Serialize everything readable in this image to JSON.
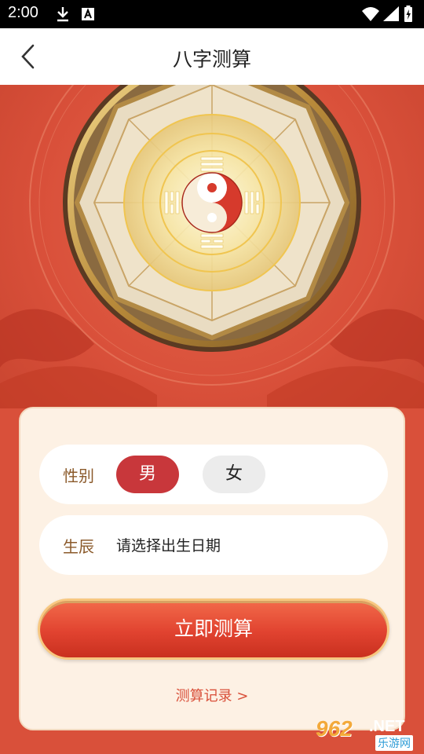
{
  "status_bar": {
    "time": "2:00"
  },
  "nav": {
    "title": "八字测算"
  },
  "form": {
    "gender_label": "性别",
    "gender_options": [
      "男",
      "女"
    ],
    "gender_selected": "男",
    "birth_label": "生辰",
    "birth_placeholder": "请选择出生日期",
    "submit_label": "立即测算",
    "history_link": "测算记录 >"
  },
  "watermark": {
    "number": "962",
    "net": ".NET",
    "site": "乐游网"
  },
  "colors": {
    "background": "#d9503a",
    "primary_red": "#c8373b",
    "card_bg": "#fdf1e4",
    "label_brown": "#8b5a2b",
    "gold": "#d4a84a"
  }
}
